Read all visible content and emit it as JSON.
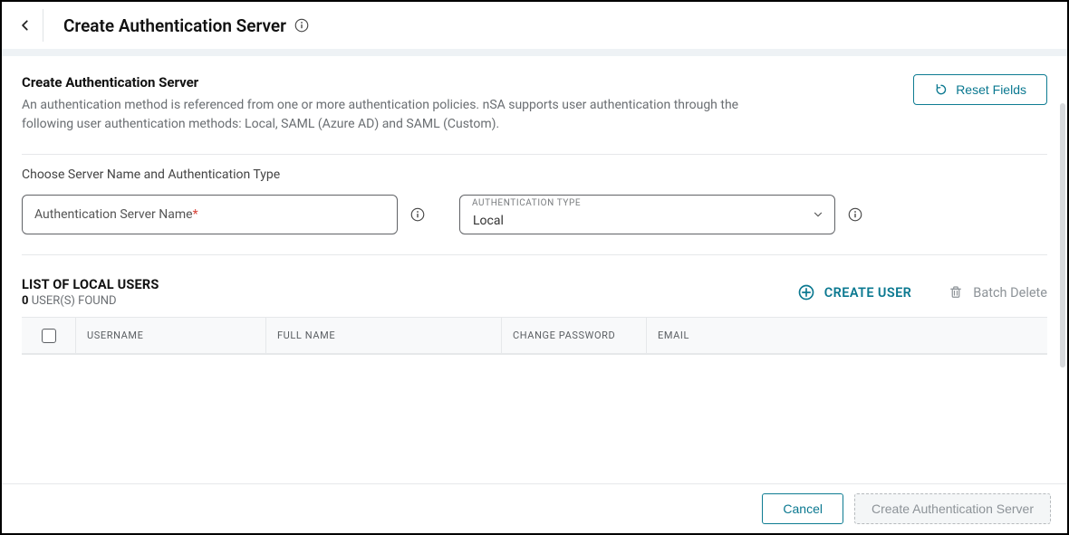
{
  "header": {
    "title": "Create Authentication Server"
  },
  "section": {
    "title": "Create Authentication Server",
    "description": "An authentication method is referenced from one or more authentication policies. nSA supports user authentication through the following user authentication methods: Local, SAML (Azure AD) and SAML (Custom)."
  },
  "reset_label": "Reset Fields",
  "choose_label": "Choose Server Name and Authentication Type",
  "server_name": {
    "placeholder": "Authentication Server Name",
    "required_mark": "*",
    "value": ""
  },
  "auth_type": {
    "label": "AUTHENTICATION TYPE",
    "value": "Local"
  },
  "users_list": {
    "title": "LIST OF LOCAL USERS",
    "count": "0",
    "found_suffix": "USER(S) FOUND",
    "create_user_label": "CREATE USER",
    "batch_delete_label": "Batch Delete",
    "columns": {
      "username": "USERNAME",
      "fullname": "FULL NAME",
      "changepw": "CHANGE PASSWORD",
      "email": "EMAIL"
    }
  },
  "footer": {
    "cancel": "Cancel",
    "submit": "Create Authentication Server"
  }
}
